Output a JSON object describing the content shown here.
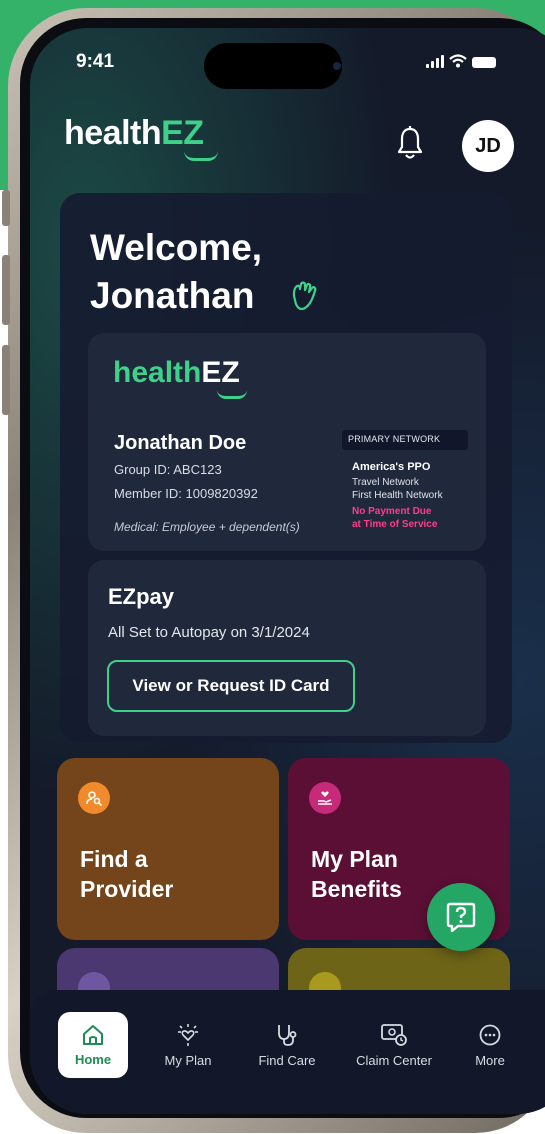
{
  "status_bar": {
    "time": "9:41"
  },
  "header": {
    "logo_main": "health",
    "logo_accent": "EZ",
    "avatar_initials": "JD"
  },
  "welcome": {
    "line1": "Welcome,",
    "line2": "Jonathan"
  },
  "id_card": {
    "logo_main": "health",
    "logo_accent": "EZ",
    "member_name": "Jonathan Doe",
    "group_id": "Group ID: ABC123",
    "member_id": "Member ID: 1009820392",
    "coverage": "Medical: Employee + dependent(s)",
    "network_label": "PRIMARY NETWORK",
    "network_name": "America's PPO",
    "network_lines": [
      "Travel Network",
      "First Health Network"
    ],
    "payment_note_line1": "No Payment Due",
    "payment_note_line2": "at Time of Service"
  },
  "ezpay": {
    "title": "EZpay",
    "status": "All Set to Autopay on 3/1/2024",
    "button_label": "View or Request ID Card"
  },
  "tiles": [
    {
      "label_line1": "Find a",
      "label_line2": "Provider"
    },
    {
      "label_line1": "My Plan",
      "label_line2": "Benefits"
    }
  ],
  "tabbar": {
    "items": [
      {
        "label": "Home"
      },
      {
        "label": "My Plan"
      },
      {
        "label": "Find Care"
      },
      {
        "label": "Claim Center"
      },
      {
        "label": "More"
      }
    ]
  },
  "colors": {
    "brand_green": "#3ed18a",
    "accent_pink": "#ff3d8b",
    "provider_tile": "#74441a",
    "benefits_tile": "#5b0f35"
  }
}
